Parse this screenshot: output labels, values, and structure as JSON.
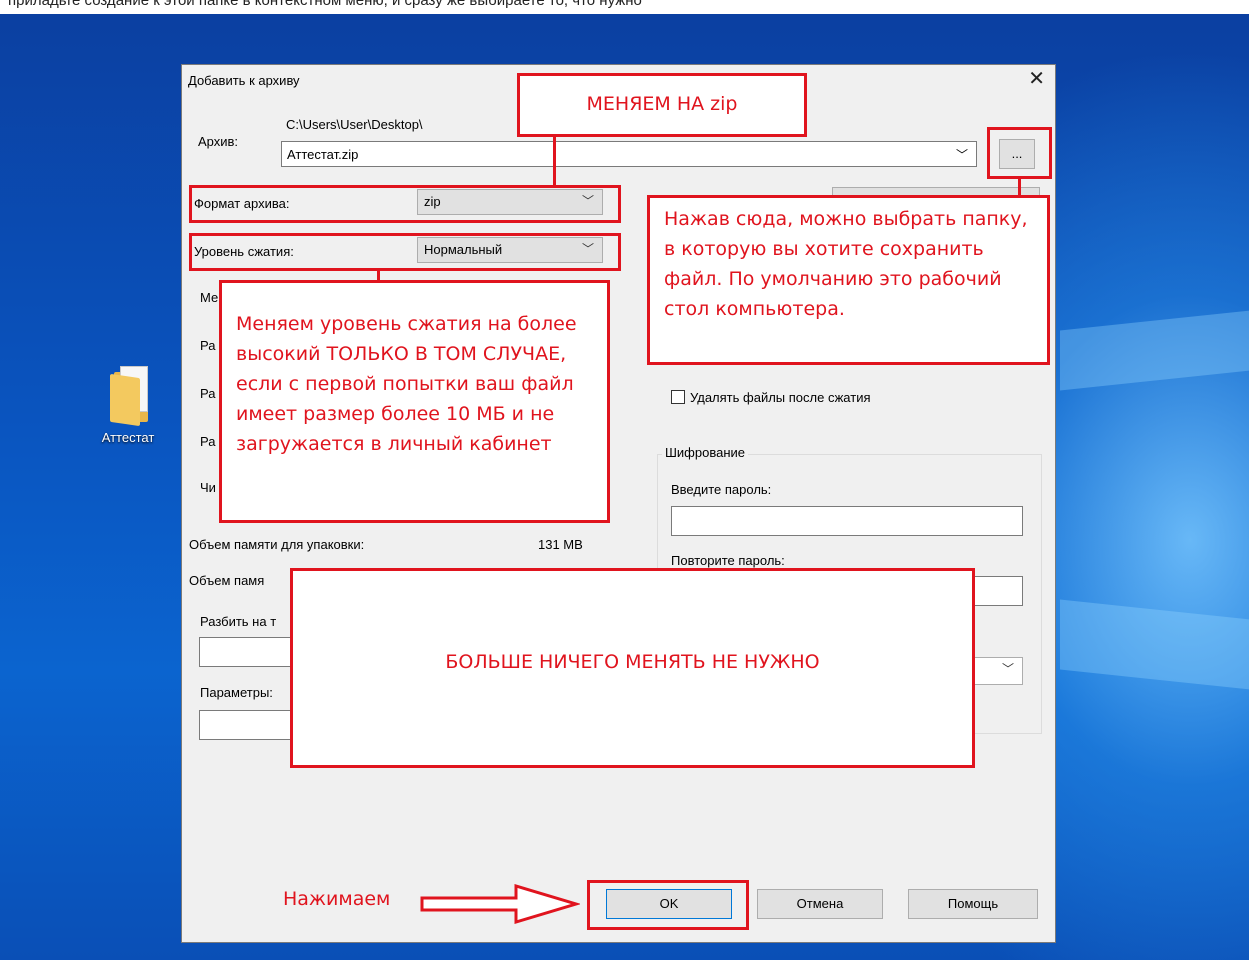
{
  "top_fragment": "приладьте создание к этой папке в контекстном меню, и сразу же выбираете то, что нужно",
  "desktop": {
    "icon_label": "Аттестат"
  },
  "dialog": {
    "title": "Добавить к архиву",
    "archive_label": "Архив:",
    "archive_path": "C:\\Users\\User\\Desktop\\",
    "archive_name": "Аттестат.zip",
    "browse_label": "...",
    "format_label": "Формат архива:",
    "format_value": "zip",
    "level_label": "Уровень сжатия:",
    "level_value": "Нормальный",
    "row_method_label": "Ме",
    "row_dict_label": "Ра",
    "row_word_label": "Ра",
    "row_block_label": "Ра",
    "row_threads_label": "Чи",
    "memory_pack_label": "Объем памяти для упаковки:",
    "memory_pack_value": "131 MB",
    "memory_unpack_label": "Объем памя",
    "split_label": "Разбить на т",
    "params_label": "Параметры:",
    "delete_after_label": "Удалять файлы после сжатия",
    "encryption_title": "Шифрование",
    "password_label": "Введите пароль:",
    "repeat_password_label": "Повторите пароль:",
    "ok_label": "OK",
    "cancel_label": "Отмена",
    "help_label": "Помощь"
  },
  "annotations": {
    "change_zip": "МЕНЯЕМ НА zip",
    "browse_hint": "Нажав сюда, можно выбрать папку, в которую вы хотите сохранить файл. По умолчанию это рабочий стол компьютера.",
    "level_hint": "Меняем уровень сжатия на более высокий ТОЛЬКО В ТОМ СЛУЧАЕ, если с первой попытки ваш файл имеет размер более 10 МБ и не загружается в личный кабинет",
    "nothing_else": "БОЛЬШЕ НИЧЕГО МЕНЯТЬ НЕ НУЖНО",
    "press": "Нажимаем",
    "color": "#e0141e"
  }
}
